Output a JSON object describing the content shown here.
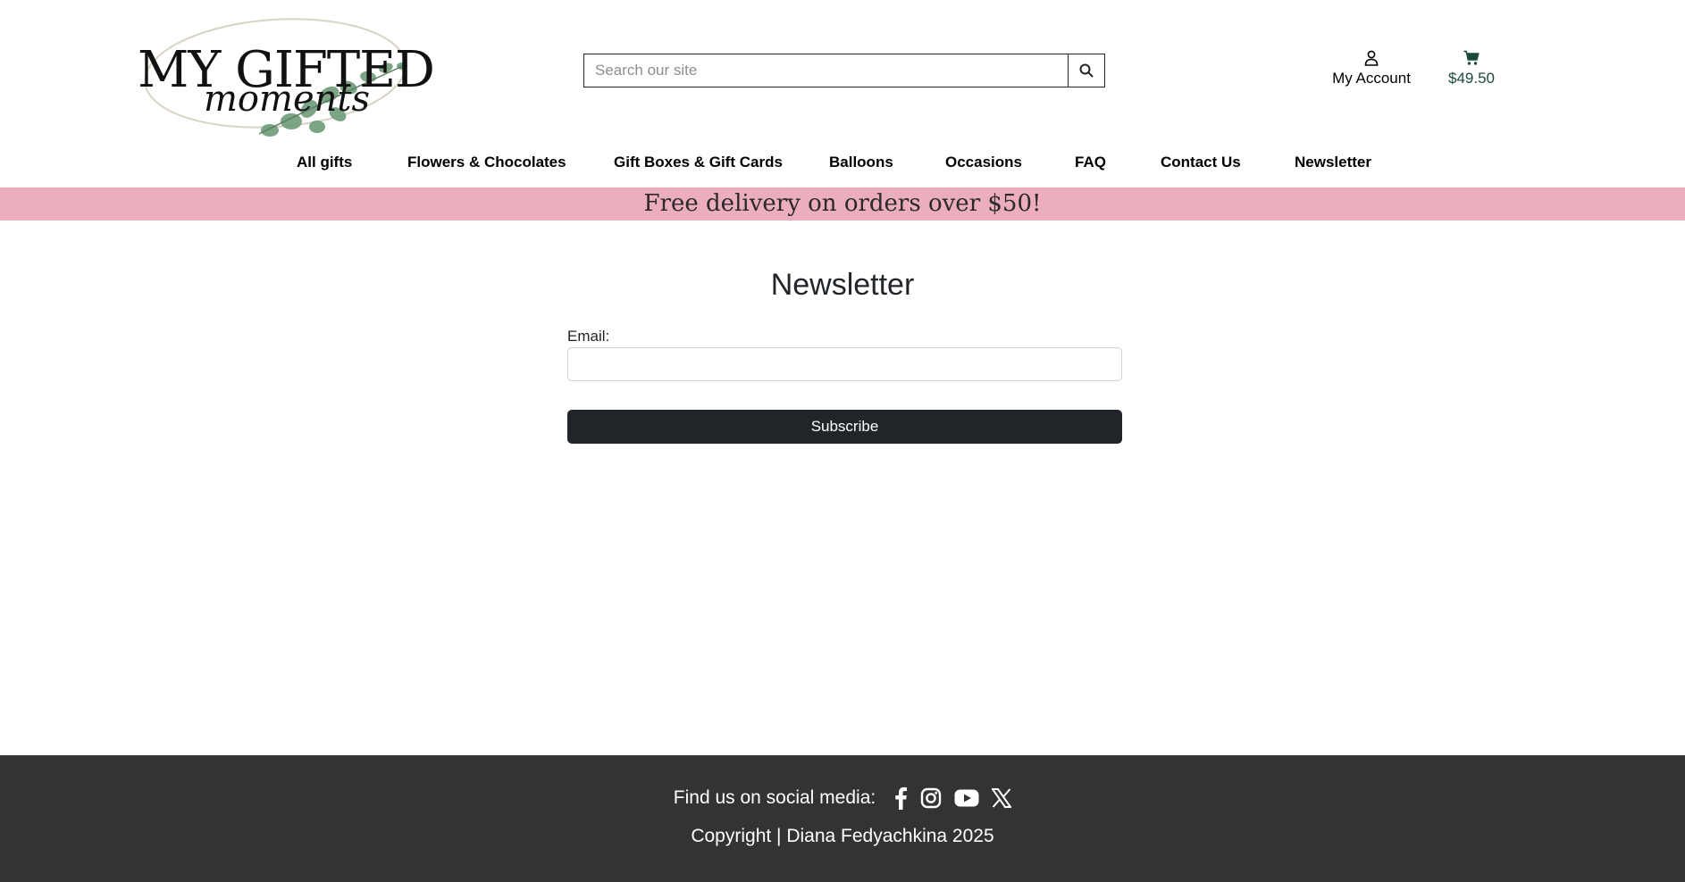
{
  "header": {
    "logo_text_line1": "MY GIFTED",
    "logo_text_line2": "moments",
    "search_placeholder": "Search our site",
    "account_label": "My Account",
    "cart_total": "$49.50"
  },
  "nav": {
    "items": [
      {
        "label": "All gifts"
      },
      {
        "label": "Flowers & Chocolates"
      },
      {
        "label": "Gift Boxes & Gift Cards"
      },
      {
        "label": "Balloons"
      },
      {
        "label": "Occasions"
      },
      {
        "label": "FAQ"
      },
      {
        "label": "Contact Us"
      },
      {
        "label": "Newsletter"
      }
    ]
  },
  "promo_banner": "Free delivery on orders over $50!",
  "main": {
    "title": "Newsletter",
    "email_label": "Email:",
    "email_value": "",
    "subscribe_label": "Subscribe"
  },
  "footer": {
    "social_label": "Find us on social media:",
    "social_icons": [
      "facebook-icon",
      "instagram-icon",
      "youtube-icon",
      "x-icon"
    ],
    "copyright": "Copyright | Diana Fedyachkina 2025"
  },
  "colors": {
    "promo_bg": "#ecadbf",
    "footer_bg": "#333333",
    "button_bg": "#212529",
    "cart_color": "#1b4a3a"
  }
}
